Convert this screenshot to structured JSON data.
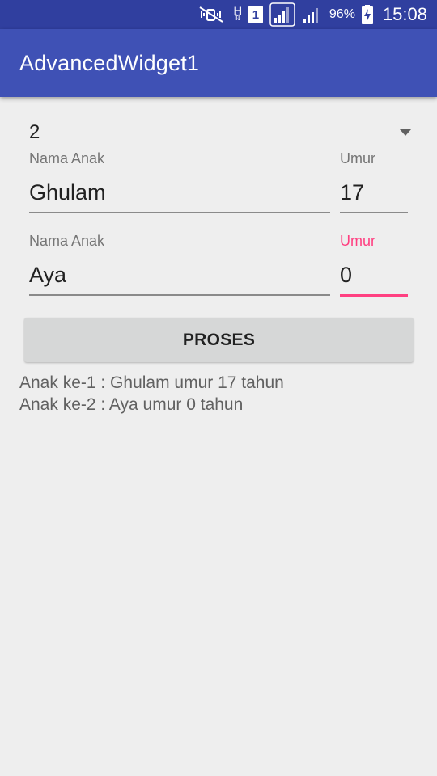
{
  "status_bar": {
    "icons": [
      "mute-vibrate-icon",
      "hsdpa-data-icon",
      "sim1-icon",
      "signal-sim1-icon",
      "signal-sim2-icon",
      "battery-charging-icon"
    ],
    "network_label": "H",
    "sim_label": "1",
    "battery": "96%",
    "time": "15:08"
  },
  "app_bar": {
    "title": "AdvancedWidget1"
  },
  "spinner": {
    "selected": "2"
  },
  "children": [
    {
      "name_label": "Nama Anak",
      "name_value": "Ghulam",
      "age_label": "Umur",
      "age_value": "17"
    },
    {
      "name_label": "Nama Anak",
      "name_value": "Aya",
      "age_label": "Umur",
      "age_value": "0"
    }
  ],
  "button": {
    "label": "PROSES"
  },
  "result": {
    "lines": [
      "Anak ke-1 : Ghulam umur 17 tahun",
      "Anak ke-2 : Aya umur 0 tahun"
    ]
  },
  "colors": {
    "status_bar": "#303f9f",
    "app_bar": "#3f51b5",
    "accent": "#ff4081",
    "background": "#eeeeee"
  }
}
